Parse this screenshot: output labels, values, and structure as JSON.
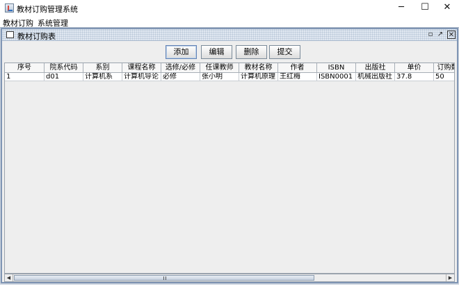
{
  "window": {
    "title": "教材订购管理系统",
    "controls": {
      "minimize": "─",
      "maximize": "☐",
      "close": "✕"
    }
  },
  "menubar": {
    "items": [
      {
        "label": "教材订购"
      },
      {
        "label": "系统管理"
      }
    ]
  },
  "internal_frame": {
    "title": "教材订购表",
    "controls": {
      "iconify": "▫",
      "maximize": "↗",
      "close": "✕"
    }
  },
  "toolbar": {
    "add_label": "添加",
    "edit_label": "编辑",
    "delete_label": "删除",
    "submit_label": "提交"
  },
  "table": {
    "columns": [
      "序号",
      "院系代码",
      "系别",
      "课程名称",
      "选修/必修",
      "任课教师",
      "教材名称",
      "作者",
      "ISBN",
      "出版社",
      "单价",
      "订购数"
    ],
    "rows": [
      [
        "1",
        "d01",
        "计算机系",
        "计算机导论",
        "必修",
        "张小明",
        "计算机原理",
        "王红梅",
        "ISBN0001",
        "机械出版社",
        "37.8",
        "50"
      ]
    ]
  },
  "scrollbar": {
    "left_arrow": "◀",
    "right_arrow": "▶"
  }
}
